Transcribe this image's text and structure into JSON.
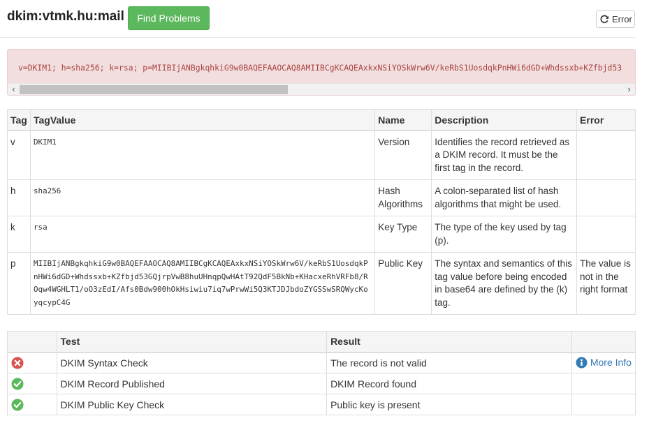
{
  "header": {
    "title": "dkim:vtmk.hu:mail",
    "find_button": "Find Problems",
    "error_button": "Error"
  },
  "record": {
    "text": "v=DKIM1; h=sha256; k=rsa; p=MIIBIjANBgkqhkiG9w0BAQEFAAOCAQ8AMIIBCgKCAQEAxkxNSiYOSkWrw6V/keRbS1UosdqkPnHWi6dGD+Whdssxb+KZfbjd53"
  },
  "tag_table": {
    "headers": [
      "Tag",
      "TagValue",
      "Name",
      "Description",
      "Error"
    ],
    "rows": [
      {
        "tag": "v",
        "value": "DKIM1",
        "name": "Version",
        "description": "Identifies the record retrieved as a DKIM record. It must be the first tag in the record.",
        "error": ""
      },
      {
        "tag": "h",
        "value": "sha256",
        "name": "Hash Algorithms",
        "description": "A colon-separated list of hash algorithms that might be used.",
        "error": ""
      },
      {
        "tag": "k",
        "value": "rsa",
        "name": "Key Type",
        "description": "The type of the key used by tag (p).",
        "error": ""
      },
      {
        "tag": "p",
        "value": "MIIBIjANBgkqhkiG9w0BAQEFAAOCAQ8AMIIBCgKCAQEAxkxNSiYOSkWrw6V/keRbS1UosdqkPnHWi6dGD+Whdssxb+KZfbjd53GQjrpVwB8huUHnqpQwHAtT92QdF5BkNb+KHacxeRhVRFb8/ROqw4WGHLT1/oO3zEdI/Afs0Bdw900hOkHsiwiu7iq7wPrwWi5Q3KTJDJbdoZYGSSwSRQWycKoyqcypC4G",
        "name": "Public Key",
        "description": "The syntax and semantics of this tag value before being encoded in base64 are defined by the (k) tag.",
        "error": "The value is not in the right format"
      }
    ]
  },
  "test_table": {
    "headers": [
      "",
      "Test",
      "Result",
      ""
    ],
    "rows": [
      {
        "status": "error",
        "test": "DKIM Syntax Check",
        "result": "The record is not valid",
        "action": "More Info"
      },
      {
        "status": "ok",
        "test": "DKIM Record Published",
        "result": "DKIM Record found",
        "action": ""
      },
      {
        "status": "ok",
        "test": "DKIM Public Key Check",
        "result": "Public key is present",
        "action": ""
      }
    ]
  },
  "colors": {
    "success": "#5cb85c",
    "danger": "#d9534f",
    "info": "#337ab7",
    "record_bg": "#f2dede",
    "record_text": "#a94442"
  },
  "icons": {
    "refresh": "refresh-icon",
    "error": "x-circle-icon",
    "ok": "check-circle-icon",
    "info": "info-circle-icon"
  }
}
